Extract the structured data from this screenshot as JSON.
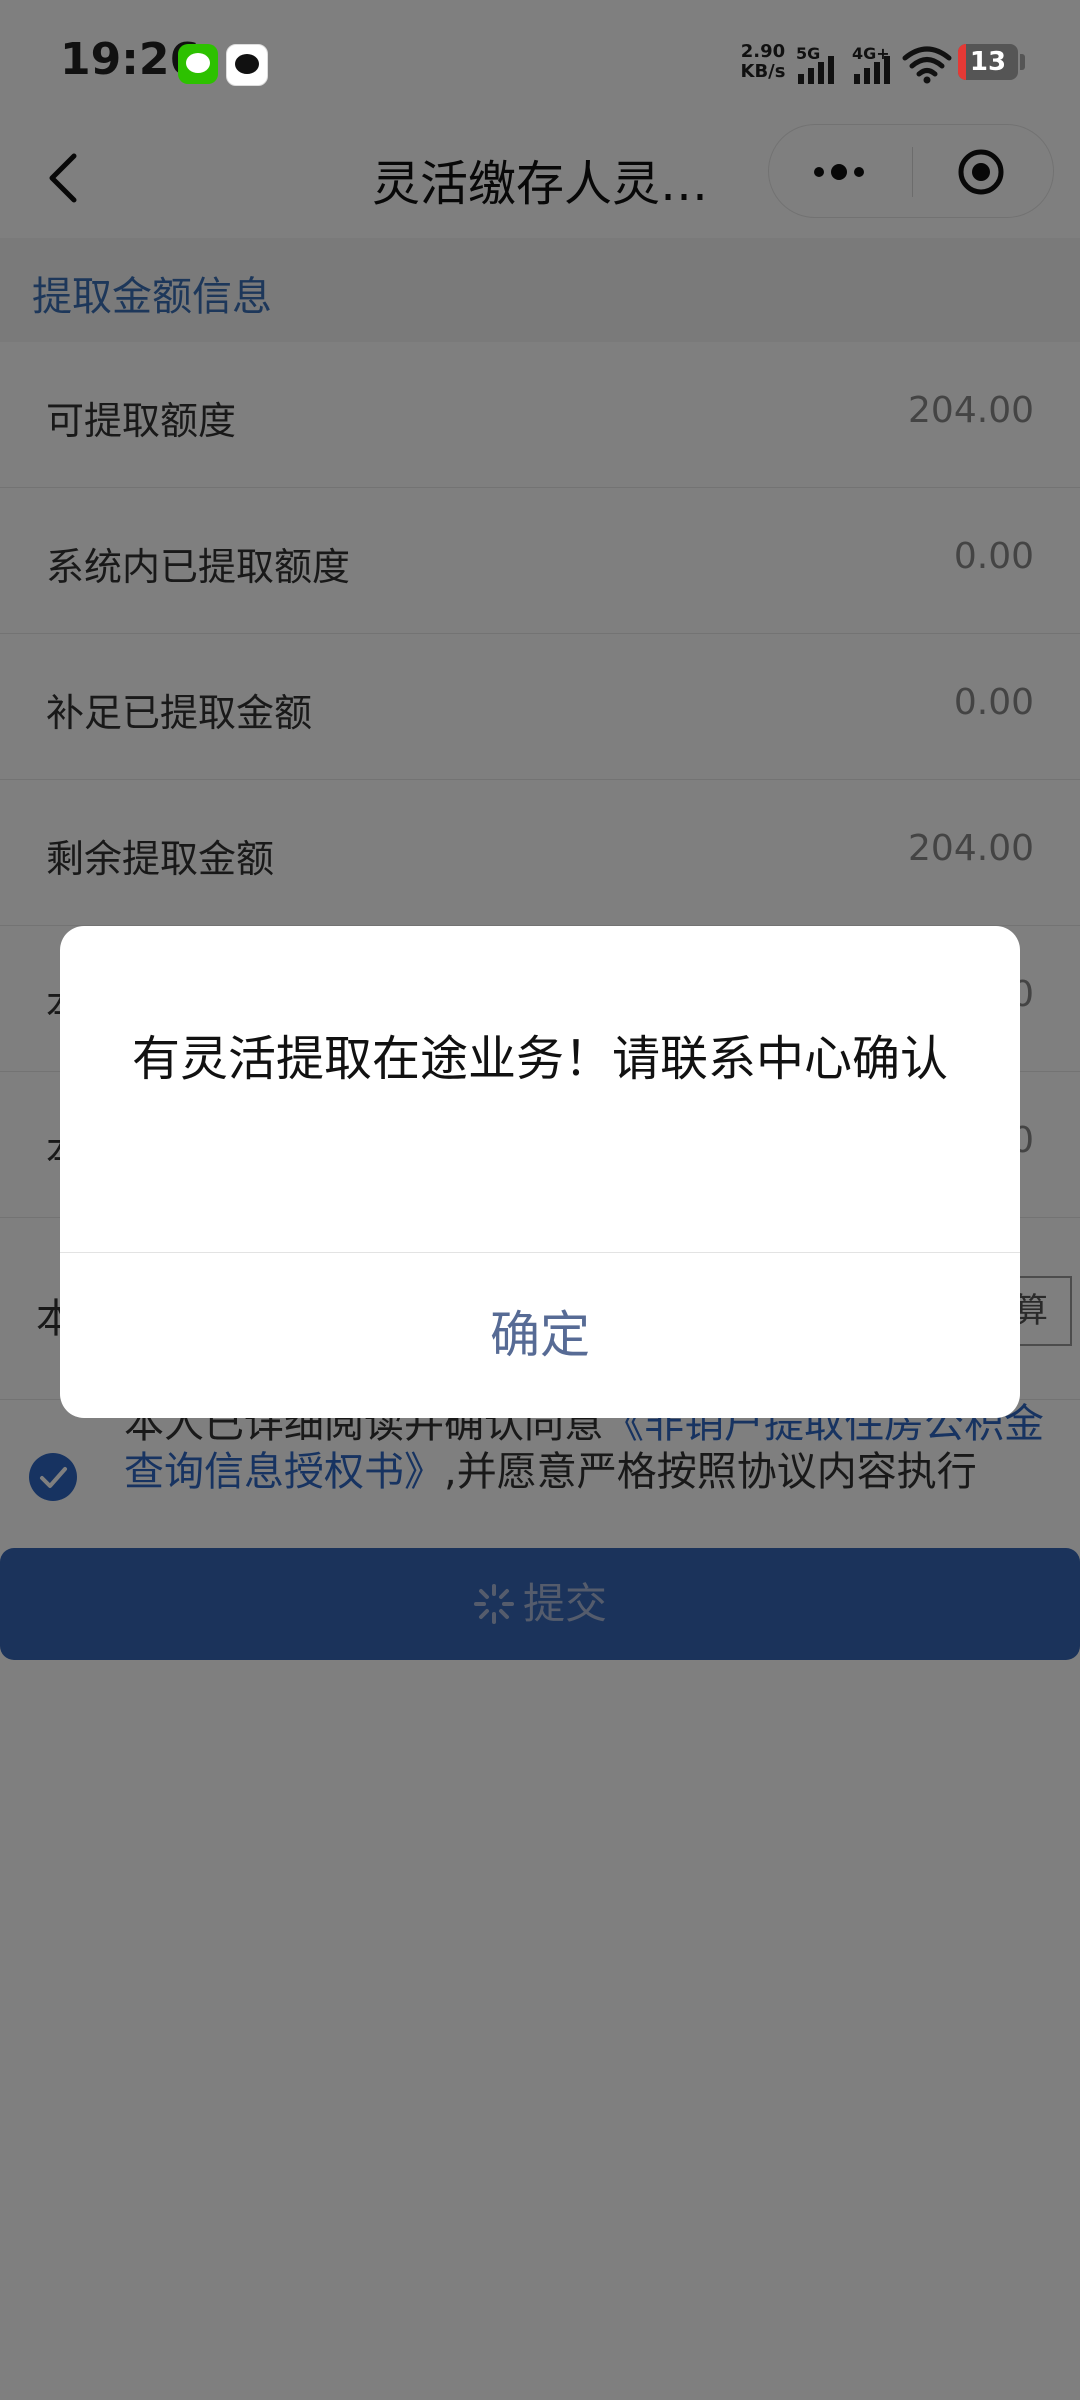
{
  "status_bar": {
    "time": "19:26",
    "net_speed_value": "2.90",
    "net_speed_unit": "KB/s",
    "signal_1_label": "5G",
    "signal_2_label": "4G+",
    "battery_level": "13",
    "battery_fraction": 0.13
  },
  "nav": {
    "title": "灵活缴存人灵…"
  },
  "section": {
    "title": "提取金额信息"
  },
  "rows": [
    {
      "label": "可提取额度",
      "value": "204.00"
    },
    {
      "label": "系统内已提取额度",
      "value": "0.00"
    },
    {
      "label": "补足已提取金额",
      "value": "0.00"
    },
    {
      "label": "剩余提取金额",
      "value": "204.00"
    },
    {
      "label": "本",
      "value": "0"
    },
    {
      "label": "本",
      "value": "0"
    }
  ],
  "calc": {
    "label": "本",
    "button_label": "算"
  },
  "agreement": {
    "prefix": "本人已详细阅读并确认同意",
    "link": "《非销户提取住房公积金查询信息授权书》",
    "suffix": ",并愿意严格按照协议内容执行"
  },
  "submit": {
    "label": "提交"
  },
  "dialog": {
    "message": "有灵活提取在途业务！请联系中心确认",
    "confirm_label": "确定"
  },
  "colors": {
    "accent": "#3667b6",
    "link": "#2f67c3",
    "section_title": "#3a6fb5",
    "dialog_button": "#576b95",
    "mask": "rgba(0,0,0,0.5)"
  }
}
